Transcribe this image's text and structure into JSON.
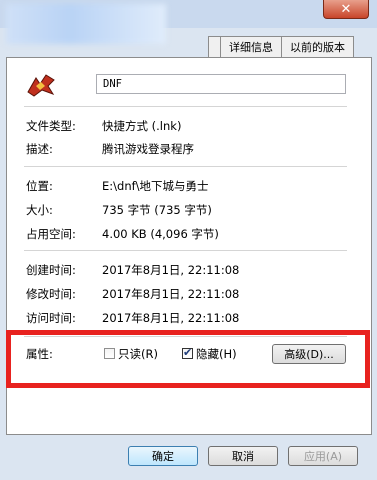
{
  "window": {
    "close_label": "✕"
  },
  "tabs": [
    "详细信息",
    "以前的版本"
  ],
  "file_name": "DNF",
  "fields": [
    {
      "label": "文件类型:",
      "value": "快捷方式 (.lnk)"
    },
    {
      "label": "描述:",
      "value": "腾讯游戏登录程序"
    },
    {
      "label": "位置:",
      "value": "E:\\dnf\\地下城与勇士"
    },
    {
      "label": "大小:",
      "value": "735 字节 (735 字节)"
    },
    {
      "label": "占用空间:",
      "value": "4.00 KB (4,096 字节)"
    },
    {
      "label": "创建时间:",
      "value": "2017年8月1日, 22:11:08"
    },
    {
      "label": "修改时间:",
      "value": "2017年8月1日, 22:11:08"
    },
    {
      "label": "访问时间:",
      "value": "2017年8月1日, 22:11:08"
    }
  ],
  "attributes": {
    "label": "属性:",
    "readonly": {
      "label": "只读(R)",
      "checked": false
    },
    "hidden": {
      "label": "隐藏(H)",
      "checked": true
    },
    "advanced": "高级(D)..."
  },
  "buttons": {
    "ok": "确定",
    "cancel": "取消",
    "apply": "应用(A)"
  },
  "colors": {
    "highlight_box": "#e8221f"
  }
}
